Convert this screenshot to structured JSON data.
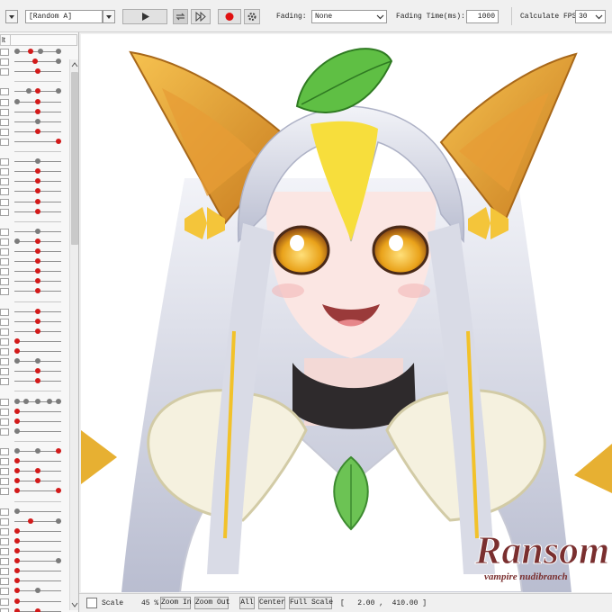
{
  "toolbar": {
    "motion_select": "[Random A]",
    "fading_label": "Fading:",
    "fading_value": "None",
    "fading_time_label": "Fading Time(ms):",
    "fading_time_value": "1000",
    "fps_label": "Calculate FPS",
    "fps_value": "30"
  },
  "left_panel": {
    "header_label": "lt",
    "rows": [
      {
        "knobs": [
          {
            "p": 0.05,
            "red": false
          },
          {
            "p": 0.35,
            "red": true
          },
          {
            "p": 0.55,
            "red": false
          },
          {
            "p": 0.95,
            "red": false
          }
        ]
      },
      {
        "knobs": [
          {
            "p": 0.45,
            "red": true
          },
          {
            "p": 0.95,
            "red": false
          }
        ]
      },
      {
        "knobs": [
          {
            "p": 0.5,
            "red": true
          }
        ]
      },
      {
        "separator": true
      },
      {
        "knobs": [
          {
            "p": 0.3,
            "red": false
          },
          {
            "p": 0.5,
            "red": true
          },
          {
            "p": 0.95,
            "red": false
          }
        ]
      },
      {
        "knobs": [
          {
            "p": 0.05,
            "red": false
          },
          {
            "p": 0.5,
            "red": true
          }
        ]
      },
      {
        "knobs": [
          {
            "p": 0.5,
            "red": true
          }
        ]
      },
      {
        "knobs": [
          {
            "p": 0.5,
            "red": false
          }
        ]
      },
      {
        "knobs": [
          {
            "p": 0.5,
            "red": true
          }
        ]
      },
      {
        "knobs": [
          {
            "p": 0.95,
            "red": true
          }
        ]
      },
      {
        "separator": true
      },
      {
        "knobs": [
          {
            "p": 0.5,
            "red": false
          }
        ]
      },
      {
        "knobs": [
          {
            "p": 0.5,
            "red": true
          }
        ]
      },
      {
        "knobs": [
          {
            "p": 0.5,
            "red": true
          }
        ]
      },
      {
        "knobs": [
          {
            "p": 0.5,
            "red": true
          }
        ]
      },
      {
        "knobs": [
          {
            "p": 0.5,
            "red": true
          }
        ]
      },
      {
        "knobs": [
          {
            "p": 0.5,
            "red": true
          }
        ]
      },
      {
        "separator": true
      },
      {
        "knobs": [
          {
            "p": 0.5,
            "red": false
          }
        ]
      },
      {
        "knobs": [
          {
            "p": 0.05,
            "red": false
          },
          {
            "p": 0.5,
            "red": true
          }
        ]
      },
      {
        "knobs": [
          {
            "p": 0.5,
            "red": true
          }
        ]
      },
      {
        "knobs": [
          {
            "p": 0.5,
            "red": true
          }
        ]
      },
      {
        "knobs": [
          {
            "p": 0.5,
            "red": true
          }
        ]
      },
      {
        "knobs": [
          {
            "p": 0.5,
            "red": true
          }
        ]
      },
      {
        "knobs": [
          {
            "p": 0.5,
            "red": true
          }
        ]
      },
      {
        "separator": true
      },
      {
        "knobs": [
          {
            "p": 0.5,
            "red": true
          }
        ]
      },
      {
        "knobs": [
          {
            "p": 0.5,
            "red": true
          }
        ]
      },
      {
        "knobs": [
          {
            "p": 0.5,
            "red": true
          }
        ]
      },
      {
        "knobs": [
          {
            "p": 0.05,
            "red": true
          }
        ]
      },
      {
        "knobs": [
          {
            "p": 0.05,
            "red": true
          }
        ]
      },
      {
        "knobs": [
          {
            "p": 0.05,
            "red": false
          },
          {
            "p": 0.5,
            "red": false
          }
        ]
      },
      {
        "knobs": [
          {
            "p": 0.5,
            "red": true
          }
        ]
      },
      {
        "knobs": [
          {
            "p": 0.5,
            "red": true
          }
        ]
      },
      {
        "separator": true
      },
      {
        "knobs": [
          {
            "p": 0.05,
            "red": false
          },
          {
            "p": 0.25,
            "red": false
          },
          {
            "p": 0.5,
            "red": false
          },
          {
            "p": 0.75,
            "red": false
          },
          {
            "p": 0.95,
            "red": false
          }
        ]
      },
      {
        "knobs": [
          {
            "p": 0.05,
            "red": true
          }
        ]
      },
      {
        "knobs": [
          {
            "p": 0.05,
            "red": true
          }
        ]
      },
      {
        "knobs": [
          {
            "p": 0.05,
            "red": false
          }
        ]
      },
      {
        "separator": true
      },
      {
        "knobs": [
          {
            "p": 0.05,
            "red": false
          },
          {
            "p": 0.5,
            "red": false
          },
          {
            "p": 0.95,
            "red": true
          }
        ]
      },
      {
        "knobs": [
          {
            "p": 0.05,
            "red": true
          }
        ]
      },
      {
        "knobs": [
          {
            "p": 0.05,
            "red": true
          },
          {
            "p": 0.5,
            "red": true
          }
        ]
      },
      {
        "knobs": [
          {
            "p": 0.05,
            "red": true
          },
          {
            "p": 0.5,
            "red": true
          }
        ]
      },
      {
        "knobs": [
          {
            "p": 0.05,
            "red": true
          },
          {
            "p": 0.95,
            "red": true
          }
        ]
      },
      {
        "separator": true
      },
      {
        "knobs": [
          {
            "p": 0.05,
            "red": false
          }
        ]
      },
      {
        "knobs": [
          {
            "p": 0.35,
            "red": true
          },
          {
            "p": 0.95,
            "red": false
          }
        ]
      },
      {
        "knobs": [
          {
            "p": 0.05,
            "red": true
          }
        ]
      },
      {
        "knobs": [
          {
            "p": 0.05,
            "red": true
          }
        ]
      },
      {
        "knobs": [
          {
            "p": 0.05,
            "red": true
          }
        ]
      },
      {
        "knobs": [
          {
            "p": 0.05,
            "red": true
          },
          {
            "p": 0.95,
            "red": false
          }
        ]
      },
      {
        "knobs": [
          {
            "p": 0.05,
            "red": true
          }
        ]
      },
      {
        "knobs": [
          {
            "p": 0.05,
            "red": true
          }
        ]
      },
      {
        "knobs": [
          {
            "p": 0.05,
            "red": true
          },
          {
            "p": 0.5,
            "red": false
          }
        ]
      },
      {
        "knobs": [
          {
            "p": 0.05,
            "red": true
          }
        ]
      },
      {
        "knobs": [
          {
            "p": 0.05,
            "red": true
          },
          {
            "p": 0.5,
            "red": true
          }
        ]
      }
    ]
  },
  "canvas": {
    "watermark_title": "Ransom",
    "watermark_subtitle": "vampire nudibranch"
  },
  "statusbar": {
    "scale_label": "Scale",
    "zoom_value": "45 %",
    "zoom_in": "Zoom In",
    "zoom_out": "Zoom Out",
    "all": "All",
    "center": "Center",
    "full_scale": "Full Scale",
    "coords": "[   2.00 ,  410.00 ]"
  }
}
